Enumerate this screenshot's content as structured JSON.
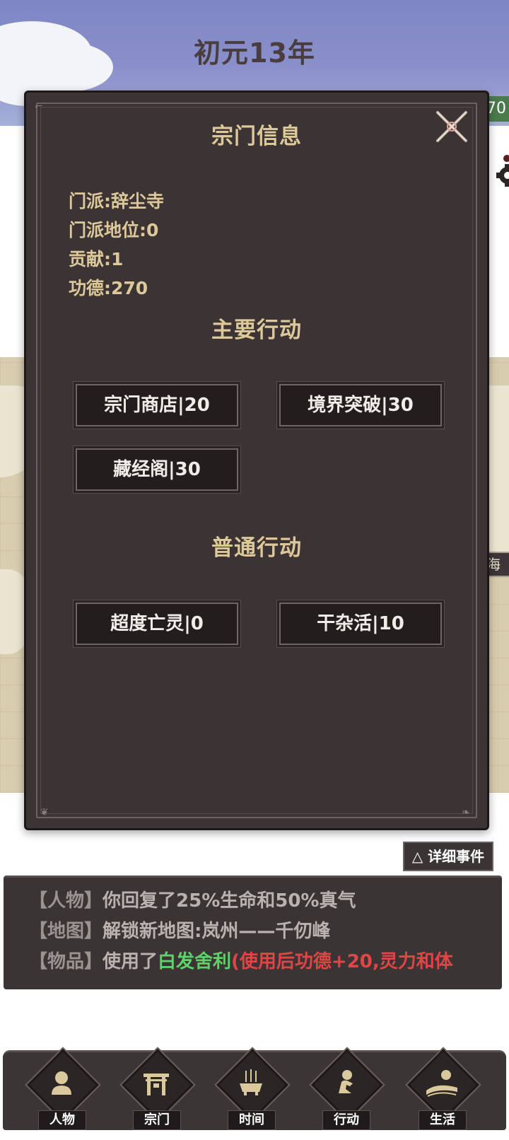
{
  "header": {
    "year_title": "初元13年",
    "side_value": "70"
  },
  "map": {
    "side_tag": "海"
  },
  "modal": {
    "sect_info_title": "宗门信息",
    "info": {
      "sect": "门派:辞尘寺",
      "position": "门派地位:0",
      "contribution": "贡献:1",
      "merit": "功德:270"
    },
    "main_actions_title": "主要行动",
    "main_actions": [
      "宗门商店|20",
      "境界突破|30",
      "藏经阁|30"
    ],
    "normal_actions_title": "普通行动",
    "normal_actions": [
      "超度亡灵|0",
      "干杂活|10"
    ]
  },
  "events": {
    "detail_button": "△ 详细事件",
    "lines": [
      {
        "tag": "【人物】",
        "text": "你回复了25%生命和50%真气"
      },
      {
        "tag": "【地图】",
        "text": "解锁新地图:岚州——千仞峰"
      },
      {
        "tag": "【物品】",
        "prefix": "使用了",
        "item": "白发舍利",
        "effect": "(使用后功德+20,灵力和体"
      }
    ]
  },
  "nav": {
    "items": [
      {
        "label": "人物",
        "icon": "person-icon"
      },
      {
        "label": "宗门",
        "icon": "gate-icon"
      },
      {
        "label": "时间",
        "icon": "incense-burner-icon"
      },
      {
        "label": "行动",
        "icon": "action-icon"
      },
      {
        "label": "生活",
        "icon": "landscape-icon"
      }
    ]
  },
  "colors": {
    "panel_bg": "#3c3434",
    "gold_text": "#ddc89a",
    "item_green": "#5fd16a",
    "effect_red": "#e14545"
  }
}
